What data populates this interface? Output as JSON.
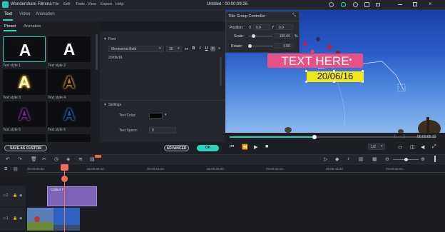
{
  "app": {
    "name": "Wondershare Filmora",
    "menu": [
      "File",
      "Edit",
      "Tools",
      "View",
      "Export",
      "Help"
    ],
    "document_title": "Untitled : 00:00:09:26"
  },
  "top_tabs": [
    "Text",
    "Video",
    "Animation"
  ],
  "sub_tabs": [
    "Preset",
    "Animation"
  ],
  "presets": [
    {
      "label": "Text style 1",
      "glyph": "A"
    },
    {
      "label": "Text style 2",
      "glyph": "A"
    },
    {
      "label": "Text style 3",
      "glyph": "A"
    },
    {
      "label": "Text style 4",
      "glyph": "A"
    },
    {
      "label": "Text style 5",
      "glyph": "A"
    },
    {
      "label": "Text style 6",
      "glyph": "A"
    }
  ],
  "font_section": {
    "header": "Font",
    "font_name": "Montserrat Bold",
    "font_size": "36",
    "format_buttons": [
      "B",
      "I",
      "U"
    ],
    "text_value": "20/06/16"
  },
  "settings_section": {
    "header": "Settings",
    "text_color_label": "Text Color:",
    "text_space_label": "Text Space:",
    "text_space_value": "0"
  },
  "buttons": {
    "save_custom": "SAVE AS CUSTOM",
    "advanced": "ADVANCED",
    "ok": "OK"
  },
  "title_group_controller": {
    "title": "Title Group Controller",
    "position_label": "Position:",
    "x_label": "X",
    "x_value": "0.0",
    "y_label": "Y",
    "y_value": "0.0",
    "scale_label": "Scale:",
    "scale_value": "100.00",
    "scale_unit": "%",
    "rotate_label": "Rotate:",
    "rotate_value": "0.00"
  },
  "preview": {
    "title_text": "TEXT HERE",
    "date_text": "20/06/16",
    "timecode": "00:00:05:10",
    "playback_progress": 0.41,
    "zoom_ratio": "1/2"
  },
  "timeline": {
    "ruler_ticks": [
      "00:00:00:00",
      "00:00:08:10",
      "00:00:16:20",
      "00:00:25:00",
      "00:00:33:10",
      "00:00:41:20",
      "00:00:50:00"
    ],
    "title_clip_name": "Callout 7"
  },
  "colors": {
    "accent": "#2ed3bd",
    "title_box": "#e85183",
    "date_box": "#f2e71c",
    "playhead": "#f26b5b"
  }
}
